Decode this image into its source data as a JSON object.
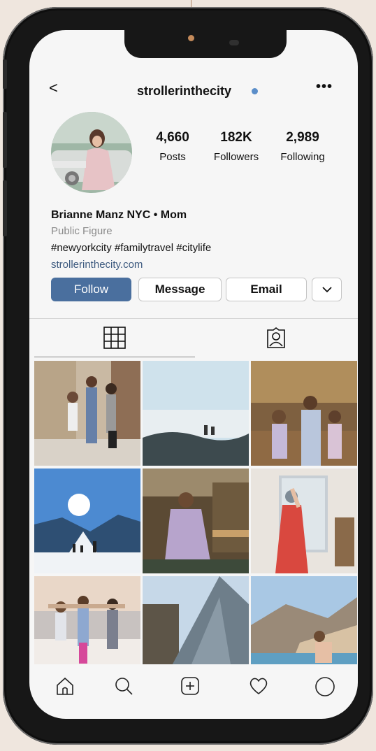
{
  "header": {
    "back_glyph": "<",
    "username": "strollerinthecity",
    "more_glyph": "•••",
    "verified_color": "#5b8ec9"
  },
  "stats": [
    {
      "value": "4,660",
      "label": "Posts"
    },
    {
      "value": "182K",
      "label": "Followers"
    },
    {
      "value": "2,989",
      "label": "Following"
    }
  ],
  "bio": {
    "name": "Brianne Manz NYC • Mom",
    "category": "Public Figure",
    "hashtags": "#newyorkcity #familytravel #citylife",
    "website": "strollerinthecity.com"
  },
  "actions": {
    "follow": "Follow",
    "message": "Message",
    "email": "Email"
  },
  "tabs": [
    "grid-icon",
    "tagged-icon"
  ],
  "bottom_nav": [
    "home-icon",
    "search-icon",
    "new-post-icon",
    "activity-heart-icon",
    "profile-icon"
  ],
  "colors": {
    "follow_button": "#4a6f9e",
    "link": "#3d5a7f",
    "background": "#efe6de"
  }
}
